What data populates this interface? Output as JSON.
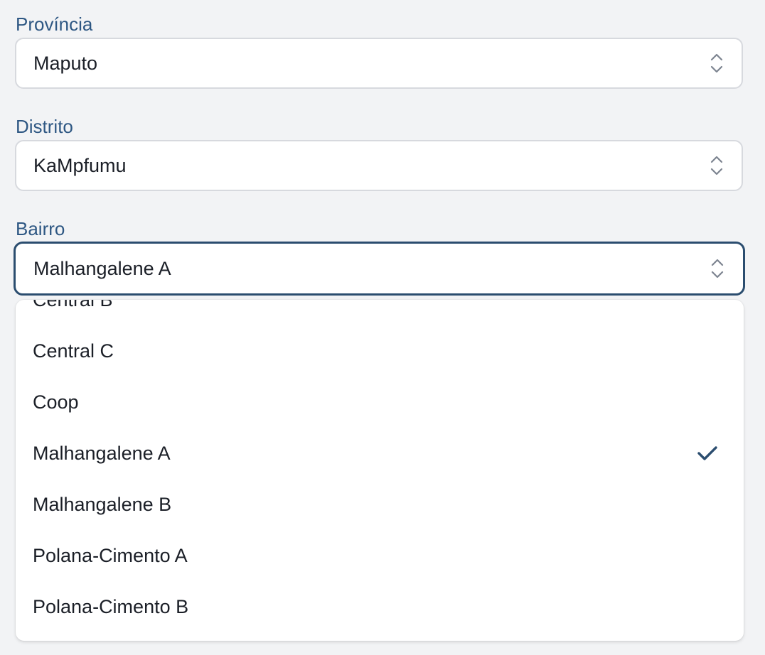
{
  "provincia": {
    "label": "Província",
    "value": "Maputo"
  },
  "distrito": {
    "label": "Distrito",
    "value": "KaMpfumu"
  },
  "bairro": {
    "label": "Bairro",
    "value": "Malhangalene A",
    "options": [
      "Central B",
      "Central C",
      "Coop",
      "Malhangalene A",
      "Malhangalene B",
      "Polana-Cimento A",
      "Polana-Cimento B"
    ],
    "selected_option": "Malhangalene A"
  },
  "icons": {
    "select_indicator": "chevron-up-down-icon",
    "selected_marker": "checkmark-icon"
  },
  "colors": {
    "label_text": "#2e5783",
    "focus_border": "#2b4d6f",
    "checkmark": "#2b4d6f",
    "page_background": "#f2f3f5"
  }
}
